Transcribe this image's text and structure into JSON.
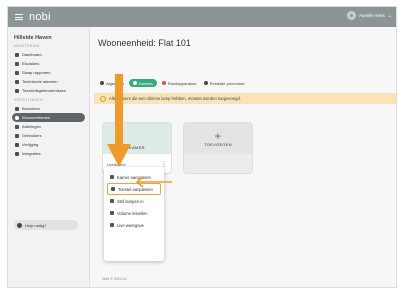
{
  "app": {
    "brand": "nobi",
    "user_name": "Aurelie Hens"
  },
  "sidebar": {
    "org": "Hillside Haven",
    "sections": {
      "monitoring": "MONITORING",
      "settings": "INSTELLINGEN"
    },
    "monitoring_items": [
      {
        "label": "Dashboard",
        "icon": "dashboard-icon"
      },
      {
        "label": "Eisdaldes",
        "icon": "pin-icon"
      },
      {
        "label": "Slaap rapporten",
        "icon": "bed-icon"
      },
      {
        "label": "Technische alarmen",
        "icon": "alarm-icon"
      },
      {
        "label": "Toezichtsgebeurtenissen",
        "icon": "eye-icon"
      }
    ],
    "settings_items": [
      {
        "label": "Bewoners",
        "icon": "users-icon",
        "active": false
      },
      {
        "label": "Wooneenheden",
        "icon": "unit-icon",
        "active": true
      },
      {
        "label": "Afdelingen",
        "icon": "building-icon",
        "active": false
      },
      {
        "label": "Gebruikers",
        "icon": "user-group-icon",
        "active": false
      },
      {
        "label": "Verlijging",
        "icon": "lock-icon",
        "active": false
      },
      {
        "label": "Integraties",
        "icon": "integration-icon",
        "active": false
      }
    ],
    "help_label": "Hulp nodig?"
  },
  "main": {
    "title": "Wooneenheid: Flat 101",
    "tabs": [
      {
        "label": "Algemeen",
        "active": false
      },
      {
        "label": "Kamers",
        "active": true
      },
      {
        "label": "Randapparatuur",
        "active": false
      },
      {
        "label": "Rondalle procedure",
        "active": false
      }
    ],
    "alert_text": "Alle kamers die een slimme lamp hebben, moeten worden toegevoegd.",
    "room_card": {
      "name": "KAMER",
      "footer_label": "Leefkamer"
    },
    "add_card": {
      "label": "TOEVOEGEN",
      "plus": "+"
    },
    "menu_items": [
      {
        "label": "Kamer aanpassen",
        "icon": "pencil-icon",
        "highlighted": false
      },
      {
        "label": "Toestel aanpassen",
        "icon": "pencil-icon",
        "highlighted": true
      },
      {
        "label": "Stel lampen in",
        "icon": "lamp-icon",
        "highlighted": false
      },
      {
        "label": "Volume instellen",
        "icon": "volume-icon",
        "highlighted": false
      },
      {
        "label": "Live weergave",
        "icon": "history-icon",
        "highlighted": false
      }
    ],
    "footer": "Nobi © 2019-24"
  },
  "colors": {
    "topbar": "#8d9496",
    "accent_green": "#35a984",
    "alert_bg": "#fbe3b6",
    "annotation_orange": "#f0a531"
  }
}
